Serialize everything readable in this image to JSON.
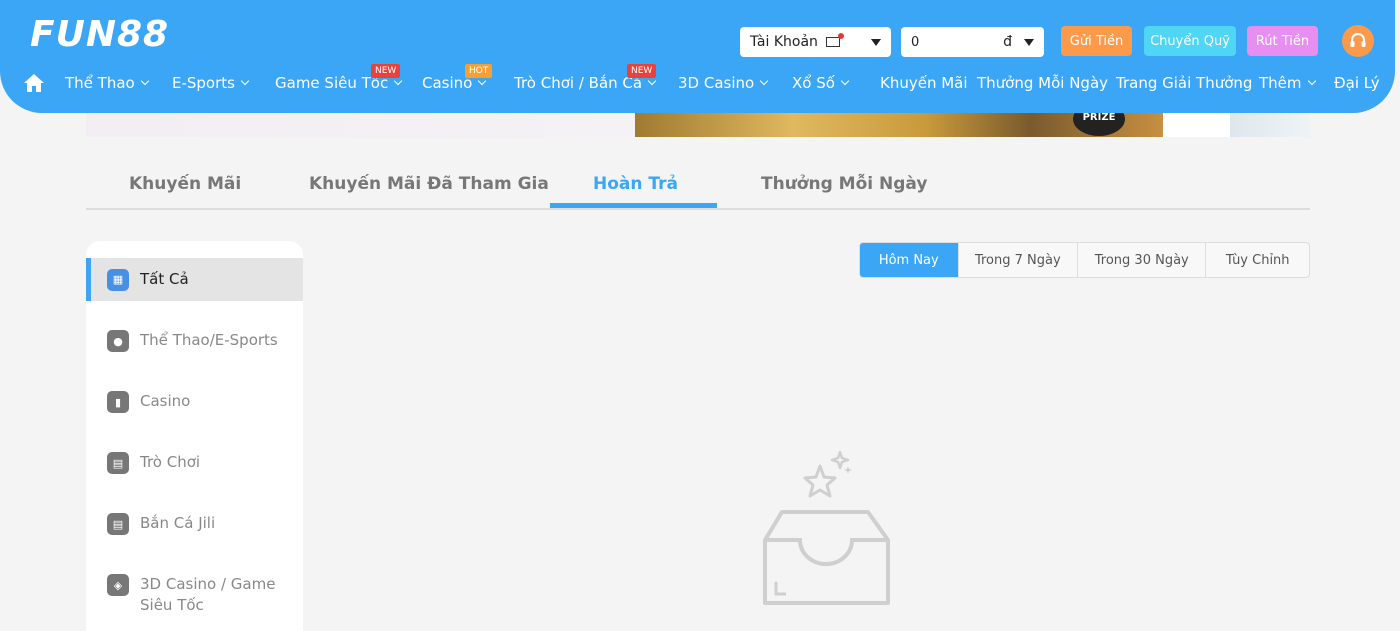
{
  "header": {
    "logo": "FUN88",
    "account_label": "Tài Khoản",
    "balance": "0",
    "currency": "đ",
    "deposit": "Gửi Tiền",
    "transfer": "Chuyển Quỹ",
    "withdraw": "Rút Tiền"
  },
  "nav": {
    "items": [
      {
        "label": "Thể Thao"
      },
      {
        "label": "E-Sports"
      },
      {
        "label": "Game Siêu Tốc",
        "badge": "NEW"
      },
      {
        "label": "Casino",
        "badge": "HOT"
      },
      {
        "label": "Trò Chơi / Bắn Cá",
        "badge": "NEW"
      },
      {
        "label": "3D Casino"
      },
      {
        "label": "Xổ Số"
      },
      {
        "label": "Khuyến Mãi"
      },
      {
        "label": "Thưởng Mỗi Ngày"
      },
      {
        "label": "Trang Giải Thưởng"
      },
      {
        "label": "Thêm"
      },
      {
        "label": "Đại Lý"
      }
    ]
  },
  "banner": {
    "prize_text": "PRIZE"
  },
  "tabs": {
    "items": [
      {
        "label": "Khuyến Mãi"
      },
      {
        "label": "Khuyến Mãi Đã Tham Gia"
      },
      {
        "label": "Hoàn Trả"
      },
      {
        "label": "Thưởng Mỗi Ngày"
      }
    ],
    "active": "Hoàn Trả"
  },
  "sidebar": {
    "items": [
      {
        "label": "Tất Cả",
        "icon": "grid-icon"
      },
      {
        "label": "Thể Thao/E-Sports",
        "icon": "soccer-ball-icon"
      },
      {
        "label": "Casino",
        "icon": "cards-icon"
      },
      {
        "label": "Trò Chơi",
        "icon": "slot-machine-icon"
      },
      {
        "label": "Bắn Cá Jili",
        "icon": "fish-icon"
      },
      {
        "label": "3D Casino / Game Siêu Tốc",
        "icon": "dice-icon"
      }
    ],
    "active": "Tất Cả"
  },
  "filters": {
    "items": [
      {
        "label": "Hôm Nay"
      },
      {
        "label": "Trong 7 Ngày"
      },
      {
        "label": "Trong 30 Ngày"
      },
      {
        "label": "Tùy Chỉnh"
      }
    ],
    "active": "Hôm Nay"
  },
  "colors": {
    "primary": "#3aa6f5",
    "deposit": "#fb9a4a",
    "transfer": "#4fd6f5",
    "withdraw": "#e78ff0",
    "badge_new": "#e8423b",
    "badge_hot": "#f5a030"
  }
}
